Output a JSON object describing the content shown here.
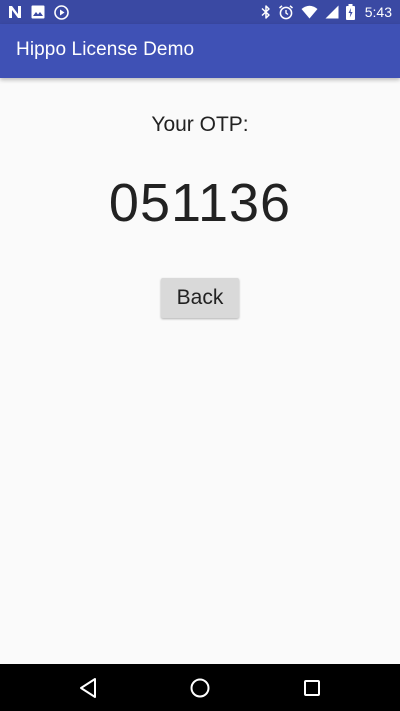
{
  "status_bar": {
    "time": "5:43",
    "left_icons": [
      "n-logo-icon",
      "image-icon",
      "play-circle-icon"
    ],
    "right_icons": [
      "bluetooth-icon",
      "alarm-icon",
      "wifi-icon",
      "signal-icon",
      "battery-icon"
    ],
    "color": "#3a49a3"
  },
  "app_bar": {
    "title": "Hippo License Demo",
    "color": "#3f51b5"
  },
  "main": {
    "otp_label": "Your OTP:",
    "otp_value": "051136",
    "back_label": "Back"
  },
  "nav_bar": {
    "items": [
      "back-triangle-icon",
      "home-circle-icon",
      "recents-square-icon"
    ]
  }
}
